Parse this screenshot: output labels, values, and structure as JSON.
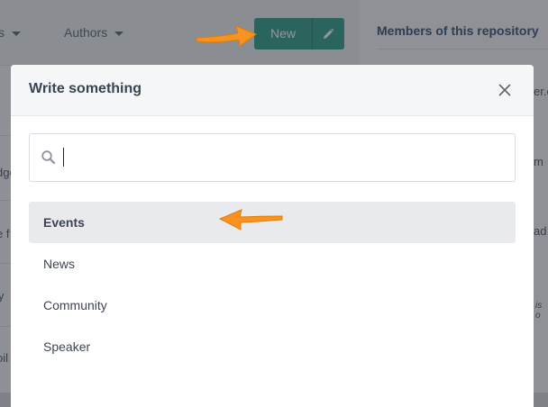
{
  "background": {
    "filters": [
      {
        "label": "s"
      },
      {
        "label": "Authors"
      }
    ],
    "new_button": {
      "label": "New"
    },
    "members_title": "Members of this repository",
    "row_fragments": [
      "dge",
      "e f",
      "y",
      "oil"
    ],
    "right_fragments": [
      "er.c",
      "m",
      "ad",
      "is o"
    ]
  },
  "modal": {
    "title": "Write something",
    "search": {
      "value": "",
      "placeholder": ""
    },
    "items": [
      {
        "label": "Events",
        "active": true
      },
      {
        "label": "News",
        "active": false
      },
      {
        "label": "Community",
        "active": false
      },
      {
        "label": "Speaker",
        "active": false
      }
    ]
  },
  "colors": {
    "accent_green": "#2e9c86",
    "callout_orange": "#f7931e",
    "active_row": "#e8eaee"
  },
  "icons": [
    "pencil-icon",
    "chevron-down-icon",
    "close-icon",
    "search-icon",
    "arrow-icon"
  ]
}
